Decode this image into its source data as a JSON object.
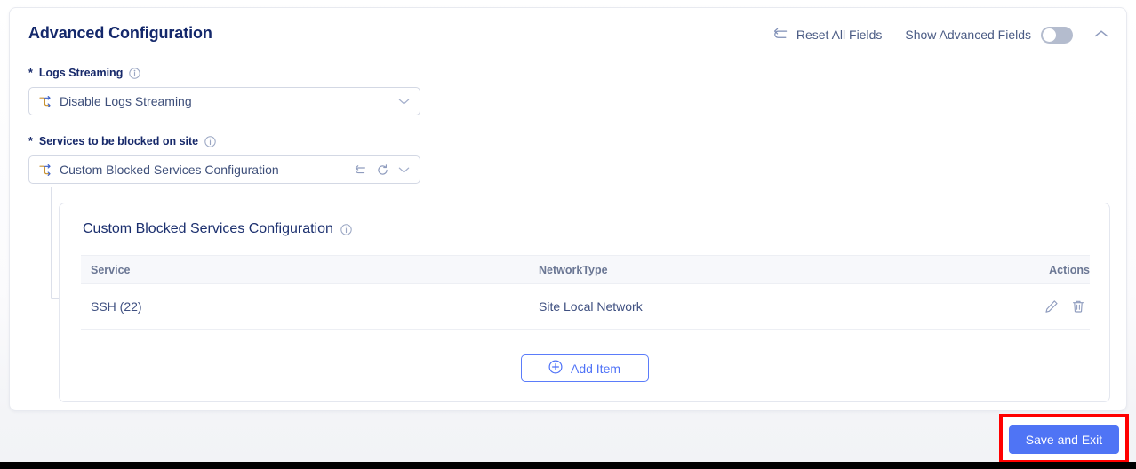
{
  "header": {
    "title": "Advanced Configuration",
    "reset_all_label": "Reset All Fields",
    "reset_all_icon": "undo-arrow-icon",
    "show_advanced_label": "Show Advanced Fields",
    "show_advanced_toggle_state": "off",
    "collapse_icon": "chevron-up-icon"
  },
  "fields": [
    {
      "required_marker": "*",
      "label": "Logs Streaming",
      "info_icon": "info-icon",
      "lead_icon": "branch-icon",
      "value": "Disable Logs Streaming",
      "chevron_icon": "chevron-down-icon"
    },
    {
      "required_marker": "*",
      "label": "Services to be blocked on site",
      "info_icon": "info-icon",
      "lead_icon": "branch-icon",
      "value": "Custom Blocked Services Configuration",
      "undo_icon": "undo-arrow-icon",
      "refresh_icon": "refresh-icon",
      "chevron_icon": "chevron-down-icon"
    }
  ],
  "inner_panel": {
    "title": "Custom Blocked Services Configuration",
    "info_icon": "info-icon",
    "table": {
      "columns": [
        "Service",
        "NetworkType",
        "Actions"
      ],
      "rows": [
        {
          "service": "SSH (22)",
          "network_type": "Site Local Network",
          "edit_icon": "pencil-icon",
          "delete_icon": "trash-icon"
        }
      ]
    },
    "add_item_label": "Add Item",
    "add_item_icon": "plus-circle-icon"
  },
  "footer": {
    "save_label": "Save and Exit"
  },
  "colors": {
    "accent_blue": "#4f74f5",
    "title_navy": "#14286b",
    "text_blue_grey": "#3e4f7a",
    "toggle_off_track": "#b4bcce",
    "highlight_red": "#ff0000",
    "table_head_bg": "#f7f8fb"
  }
}
